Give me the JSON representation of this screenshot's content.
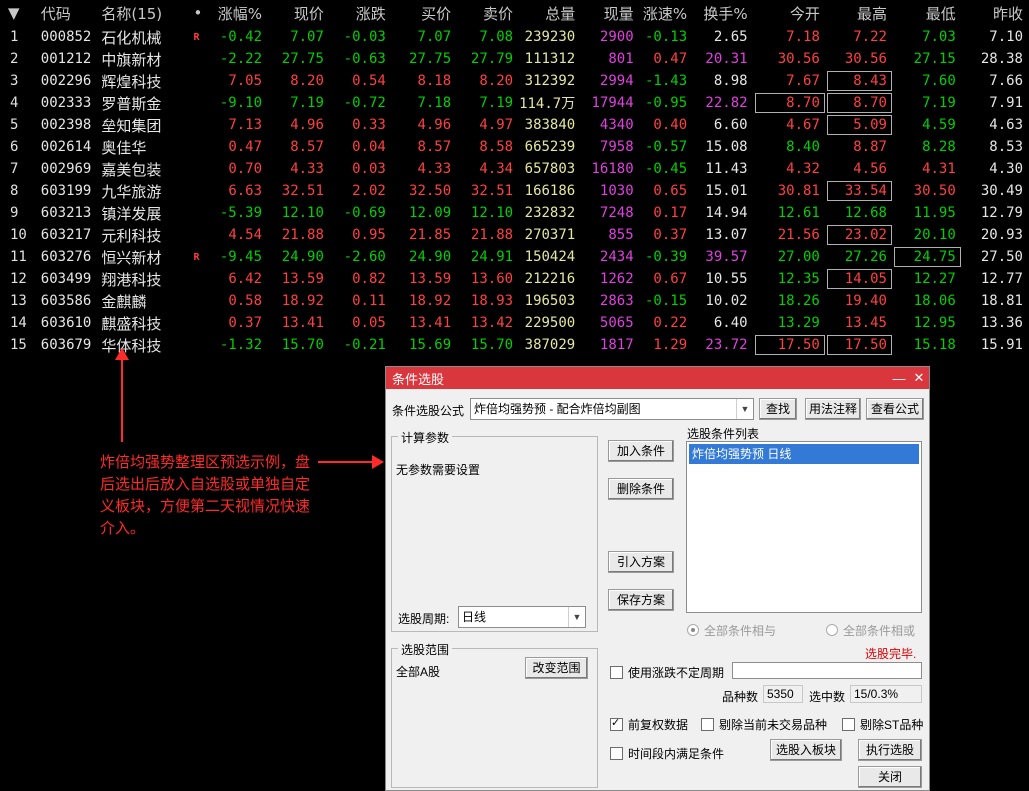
{
  "table": {
    "headers": {
      "arrow": "▼",
      "code": "代码",
      "name": "名称(15)",
      "dot": "•",
      "pct": "涨幅%",
      "price": "现价",
      "change": "涨跌",
      "bid": "买价",
      "ask": "卖价",
      "volume": "总量",
      "cur_vol": "现量",
      "speed": "涨速%",
      "turnover": "换手%",
      "open": "今开",
      "high": "最高",
      "low": "最低",
      "prev": "昨收"
    },
    "rows": [
      {
        "idx": "1",
        "code": "000852",
        "name": "石化机械",
        "flag": "R",
        "pct": "-0.42",
        "price": "7.07",
        "change": "-0.03",
        "bid": "7.07",
        "ask": "7.08",
        "volume": "239230",
        "cur_vol": "2900",
        "speed": "-0.13",
        "turnover": "2.65",
        "open": "7.18",
        "high": "7.22",
        "low": "7.03",
        "prev": "7.10"
      },
      {
        "idx": "2",
        "code": "001212",
        "name": "中旗新材",
        "flag": "",
        "pct": "-2.22",
        "price": "27.75",
        "change": "-0.63",
        "bid": "27.75",
        "ask": "27.79",
        "volume": "111312",
        "cur_vol": "801",
        "speed": "0.47",
        "turnover": "20.31",
        "open": "30.56",
        "high": "30.56",
        "low": "27.15",
        "prev": "28.38"
      },
      {
        "idx": "3",
        "code": "002296",
        "name": "辉煌科技",
        "flag": "",
        "pct": "7.05",
        "price": "8.20",
        "change": "0.54",
        "bid": "8.18",
        "ask": "8.20",
        "volume": "312392",
        "cur_vol": "2994",
        "speed": "-1.43",
        "turnover": "8.98",
        "open": "7.67",
        "high": "8.43",
        "low": "7.60",
        "prev": "7.66"
      },
      {
        "idx": "4",
        "code": "002333",
        "name": "罗普斯金",
        "flag": "",
        "pct": "-9.10",
        "price": "7.19",
        "change": "-0.72",
        "bid": "7.18",
        "ask": "7.19",
        "volume": "114.7万",
        "cur_vol": "17944",
        "speed": "-0.95",
        "turnover": "22.82",
        "open": "8.70",
        "high": "8.70",
        "low": "7.19",
        "prev": "7.91"
      },
      {
        "idx": "5",
        "code": "002398",
        "name": "垒知集团",
        "flag": "",
        "pct": "7.13",
        "price": "4.96",
        "change": "0.33",
        "bid": "4.96",
        "ask": "4.97",
        "volume": "383840",
        "cur_vol": "4340",
        "speed": "0.40",
        "turnover": "6.60",
        "open": "4.67",
        "high": "5.09",
        "low": "4.59",
        "prev": "4.63"
      },
      {
        "idx": "6",
        "code": "002614",
        "name": "奥佳华",
        "flag": "",
        "pct": "0.47",
        "price": "8.57",
        "change": "0.04",
        "bid": "8.57",
        "ask": "8.58",
        "volume": "665239",
        "cur_vol": "7958",
        "speed": "-0.57",
        "turnover": "15.08",
        "open": "8.40",
        "high": "8.87",
        "low": "8.28",
        "prev": "8.53"
      },
      {
        "idx": "7",
        "code": "002969",
        "name": "嘉美包装",
        "flag": "",
        "pct": "0.70",
        "price": "4.33",
        "change": "0.03",
        "bid": "4.33",
        "ask": "4.34",
        "volume": "657803",
        "cur_vol": "16180",
        "speed": "-0.45",
        "turnover": "11.43",
        "open": "4.32",
        "high": "4.56",
        "low": "4.31",
        "prev": "4.30"
      },
      {
        "idx": "8",
        "code": "603199",
        "name": "九华旅游",
        "flag": "",
        "pct": "6.63",
        "price": "32.51",
        "change": "2.02",
        "bid": "32.50",
        "ask": "32.51",
        "volume": "166186",
        "cur_vol": "1030",
        "speed": "0.65",
        "turnover": "15.01",
        "open": "30.81",
        "high": "33.54",
        "low": "30.50",
        "prev": "30.49"
      },
      {
        "idx": "9",
        "code": "603213",
        "name": "镇洋发展",
        "flag": "",
        "pct": "-5.39",
        "price": "12.10",
        "change": "-0.69",
        "bid": "12.09",
        "ask": "12.10",
        "volume": "232832",
        "cur_vol": "7248",
        "speed": "0.17",
        "turnover": "14.94",
        "open": "12.61",
        "high": "12.68",
        "low": "11.95",
        "prev": "12.79"
      },
      {
        "idx": "10",
        "code": "603217",
        "name": "元利科技",
        "flag": "",
        "pct": "4.54",
        "price": "21.88",
        "change": "0.95",
        "bid": "21.85",
        "ask": "21.88",
        "volume": "270371",
        "cur_vol": "855",
        "speed": "0.37",
        "turnover": "13.07",
        "open": "21.56",
        "high": "23.02",
        "low": "20.10",
        "prev": "20.93"
      },
      {
        "idx": "11",
        "code": "603276",
        "name": "恒兴新材",
        "flag": "R",
        "pct": "-9.45",
        "price": "24.90",
        "change": "-2.60",
        "bid": "24.90",
        "ask": "24.91",
        "volume": "150424",
        "cur_vol": "2434",
        "speed": "-0.39",
        "turnover": "39.57",
        "open": "27.00",
        "high": "27.26",
        "low": "24.75",
        "prev": "27.50"
      },
      {
        "idx": "12",
        "code": "603499",
        "name": "翔港科技",
        "flag": "",
        "pct": "6.42",
        "price": "13.59",
        "change": "0.82",
        "bid": "13.59",
        "ask": "13.60",
        "volume": "212216",
        "cur_vol": "1262",
        "speed": "0.67",
        "turnover": "10.55",
        "open": "12.35",
        "high": "14.05",
        "low": "12.27",
        "prev": "12.77"
      },
      {
        "idx": "13",
        "code": "603586",
        "name": "金麒麟",
        "flag": "",
        "pct": "0.58",
        "price": "18.92",
        "change": "0.11",
        "bid": "18.92",
        "ask": "18.93",
        "volume": "196503",
        "cur_vol": "2863",
        "speed": "-0.15",
        "turnover": "10.02",
        "open": "18.26",
        "high": "19.40",
        "low": "18.06",
        "prev": "18.81"
      },
      {
        "idx": "14",
        "code": "603610",
        "name": "麒盛科技",
        "flag": "",
        "pct": "0.37",
        "price": "13.41",
        "change": "0.05",
        "bid": "13.41",
        "ask": "13.42",
        "volume": "229500",
        "cur_vol": "5065",
        "speed": "0.22",
        "turnover": "6.40",
        "open": "13.29",
        "high": "13.45",
        "low": "12.95",
        "prev": "13.36"
      },
      {
        "idx": "15",
        "code": "603679",
        "name": "华体科技",
        "flag": "",
        "pct": "-1.32",
        "price": "15.70",
        "change": "-0.21",
        "bid": "15.69",
        "ask": "15.70",
        "volume": "387029",
        "cur_vol": "1817",
        "speed": "1.29",
        "turnover": "23.72",
        "open": "17.50",
        "high": "17.50",
        "low": "15.18",
        "prev": "15.91"
      }
    ]
  },
  "annotation": {
    "text": "炸倍均强势整理区预选示例，盘后选出后放入自选股或单独自定义板块，方便第二天视情况快速介入。"
  },
  "dialog": {
    "title": "条件选股",
    "min_icon": "—",
    "close_icon": "✕",
    "formula_label": "条件选股公式",
    "formula_value": "炸倍均强势预  -  配合炸倍均副图",
    "find_button": "查找",
    "usage_button": "用法注释",
    "view_formula_button": "查看公式",
    "params_group": "计算参数",
    "params_text": "无参数需要设置",
    "add_condition": "加入条件",
    "delete_condition": "删除条件",
    "import_plan": "引入方案",
    "save_plan": "保存方案",
    "cond_list_label": "选股条件列表",
    "cond_list_items": [
      "炸倍均强势预  日线"
    ],
    "period_label": "选股周期:",
    "period_value": "日线",
    "radio_and": "全部条件相与",
    "radio_or": "全部条件相或",
    "status": "选股完毕.",
    "range_group": "选股范围",
    "range_value": "全部A股",
    "change_range": "改变范围",
    "use_variable_period": "使用涨跌不定周期",
    "variety_count_label": "品种数",
    "variety_count": "5350",
    "selected_label": "选中数",
    "selected_value": "15/0.3%",
    "forward_adjust": "前复权数据",
    "exclude_untraded": "剔除当前未交易品种",
    "exclude_st": "剔除ST品种",
    "time_range": "时间段内满足条件",
    "to_board": "选股入板块",
    "execute": "执行选股",
    "close": "关闭"
  }
}
